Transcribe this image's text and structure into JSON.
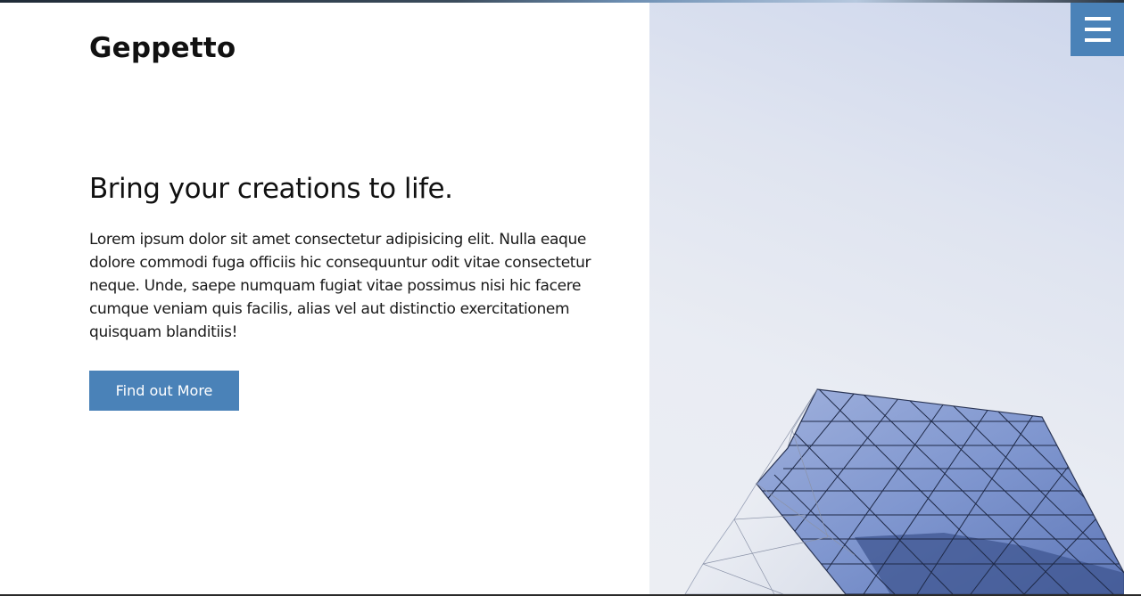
{
  "header": {
    "logo_text": "Geppetto",
    "menu_icon": "hamburger-menu-icon"
  },
  "hero": {
    "headline": "Bring your creations to life.",
    "body": "Lorem ipsum dolor sit amet consectetur adipisicing elit. Nulla eaque dolore commodi fuga officiis hic consequuntur odit vitae consectetur neque. Unde, saepe numquam fugiat vitae possimus nisi hic facere cumque veniam quis facilis, alias vel aut distinctio exercitationem quisquam blanditiis!",
    "cta_label": "Find out More"
  },
  "colors": {
    "accent": "#4a82b8",
    "text": "#111111",
    "background": "#ffffff"
  }
}
